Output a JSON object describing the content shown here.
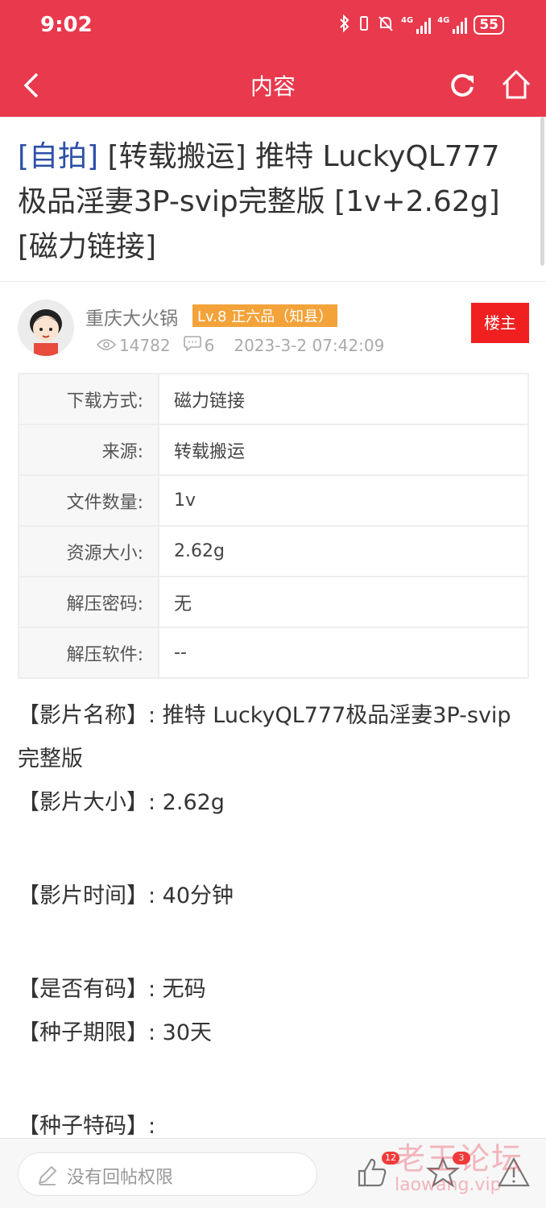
{
  "status_bar": {
    "time": "9:02",
    "signal1": "4G",
    "signal2": "4G",
    "battery": "55"
  },
  "nav": {
    "title": "内容"
  },
  "post": {
    "title_tag": "[自拍]",
    "title_rest": " [转载搬运] 推特 LuckyQL777极品淫妻3P-svip完整版 [1v+2.62g] [磁力链接]"
  },
  "author": {
    "name": "重庆大火锅",
    "level": "Lv.8 正六品（知县）",
    "views": "14782",
    "replies": "6",
    "datetime": "2023-3-2 07:42:09",
    "op_badge": "楼主"
  },
  "info_table": [
    {
      "key": "下载方式:",
      "value": "磁力链接"
    },
    {
      "key": "来源:",
      "value": "转载搬运"
    },
    {
      "key": "文件数量:",
      "value": "1v"
    },
    {
      "key": "资源大小:",
      "value": "2.62g"
    },
    {
      "key": "解压密码:",
      "value": "无"
    },
    {
      "key": "解压软件:",
      "value": "--"
    }
  ],
  "body": {
    "line1": "【影片名称】: 推特 LuckyQL777极品淫妻3P-svip完整版",
    "line2": "【影片大小】: 2.62g",
    "line3": "【影片时间】: 40分钟",
    "line4": "【是否有码】: 无码",
    "line5": "【种子期限】: 30天",
    "line6": "【种子特码】:"
  },
  "bottom": {
    "reply_placeholder": "没有回帖权限",
    "like_count": "12",
    "fav_count": "3"
  },
  "watermark": {
    "line1": "老王论坛",
    "line2": "laowang.vip"
  },
  "colors": {
    "brand": "#e8394d",
    "level_badge": "#f3a33a",
    "op_badge": "#f02020",
    "title_tag": "#2c4fa8"
  }
}
